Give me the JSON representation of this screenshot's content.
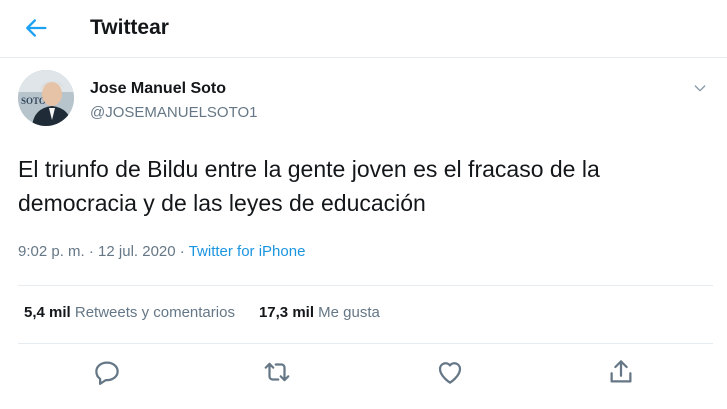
{
  "header": {
    "title": "Twittear",
    "back_icon": "arrow-left-icon"
  },
  "tweet": {
    "author_name": "Jose Manuel Soto",
    "author_handle": "@JOSEMANUELSOTO1",
    "avatar_text": "SOTO",
    "text": "El triunfo de Bildu entre la gente joven es el fracaso de la democracia y de las leyes de educación",
    "time": "9:02 p. m.",
    "separator": " · ",
    "date": "12 jul. 2020",
    "source": "Twitter for iPhone"
  },
  "stats": {
    "retweets_count": "5,4 mil",
    "retweets_label": "Retweets y comentarios",
    "likes_count": "17,3 mil",
    "likes_label": "Me gusta"
  },
  "actions": [
    "reply-icon",
    "retweet-icon",
    "like-icon",
    "share-icon"
  ],
  "colors": {
    "accent": "#1da1f2",
    "link": "#1b95e0",
    "secondary_text": "#657786",
    "border": "#e6ecf0"
  }
}
